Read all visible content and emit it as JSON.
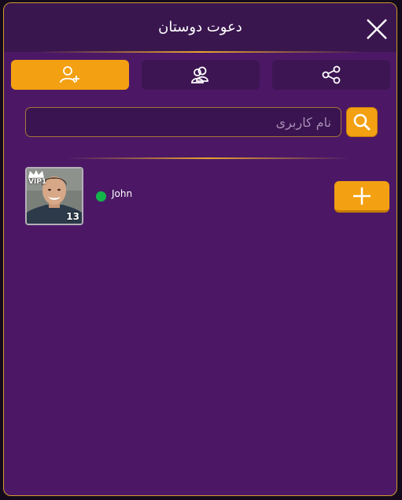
{
  "header": {
    "title": "دعوت دوستان",
    "close_icon": "close-icon"
  },
  "tabs": [
    {
      "icon": "add-user-icon",
      "active": true
    },
    {
      "icon": "group-icon",
      "active": false
    },
    {
      "icon": "share-icon",
      "active": false
    }
  ],
  "search": {
    "placeholder": "نام کاربری",
    "value": "",
    "icon": "search-icon"
  },
  "users": [
    {
      "name": "John",
      "level": "13",
      "badge": "VIP1",
      "online": true,
      "add_icon": "plus-icon"
    }
  ],
  "colors": {
    "accent": "#f3a012",
    "panel": "#4c1866",
    "header": "#3a164f",
    "online": "#14b44a"
  }
}
